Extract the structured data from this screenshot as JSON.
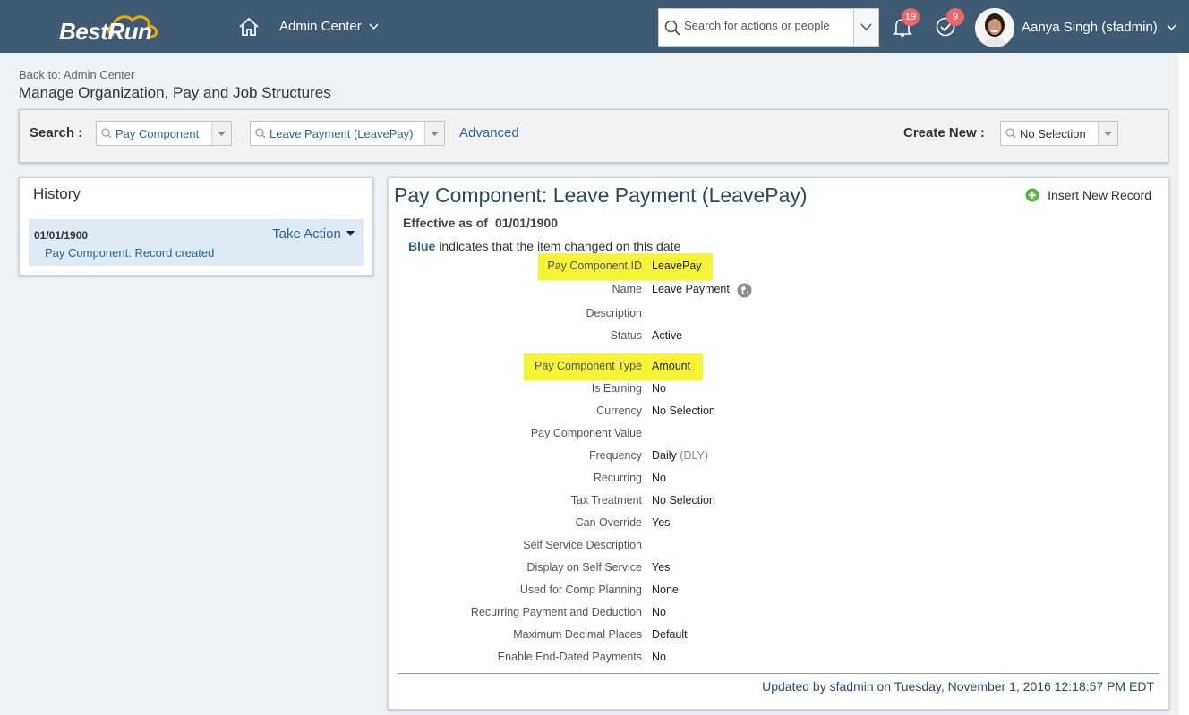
{
  "header": {
    "logo_text": "BestRun",
    "nav_title": "Admin Center",
    "search_placeholder": "Search for actions or people",
    "notifications_count": "19",
    "todo_count": "9",
    "user_name": "Aanya Singh (sfadmin)"
  },
  "breadcrumb": {
    "back_label": "Back to: Admin Center",
    "page_title": "Manage Organization, Pay and Job Structures"
  },
  "search_panel": {
    "search_label": "Search :",
    "type_value": "Pay Component",
    "record_value": "Leave Payment (LeavePay)",
    "advanced_label": "Advanced",
    "create_label": "Create New :",
    "create_value": "No Selection"
  },
  "history": {
    "title": "History",
    "items": [
      {
        "date": "01/01/1900",
        "action_label": "Take Action",
        "description": "Pay Component: Record created"
      }
    ]
  },
  "detail": {
    "title": "Pay Component: Leave Payment (LeavePay)",
    "insert_label": "Insert New Record",
    "effective_label": "Effective as of",
    "effective_date": "01/01/1900",
    "blue_word": "Blue",
    "blue_note": "indicates that the item changed on this date",
    "fields": [
      {
        "label": "Pay Component ID",
        "value": "LeavePay",
        "highlight": true
      },
      {
        "label": "Name",
        "value": "Leave Payment"
      },
      {
        "label": "Description",
        "value": ""
      },
      {
        "label": "Status",
        "value": "Active"
      },
      {
        "label": "Pay Component Type",
        "value": "Amount",
        "highlight": true
      },
      {
        "label": "Is Earning",
        "value": "No"
      },
      {
        "label": "Currency",
        "value": "No Selection"
      },
      {
        "label": "Pay Component Value",
        "value": ""
      },
      {
        "label": "Frequency",
        "value": "Daily",
        "value_extra": "(DLY)"
      },
      {
        "label": "Recurring",
        "value": "No"
      },
      {
        "label": "Tax Treatment",
        "value": "No Selection"
      },
      {
        "label": "Can Override",
        "value": "Yes"
      },
      {
        "label": "Self Service Description",
        "value": ""
      },
      {
        "label": "Display on Self Service",
        "value": "Yes"
      },
      {
        "label": "Used for Comp Planning",
        "value": "None"
      },
      {
        "label": "Recurring Payment and Deduction",
        "value": "No"
      },
      {
        "label": "Maximum Decimal Places",
        "value": "Default"
      },
      {
        "label": "Enable End-Dated Payments",
        "value": "No"
      }
    ],
    "updated_text": "Updated by sfadmin on Tuesday, November 1, 2016 12:18:57 PM EDT"
  },
  "colors": {
    "header_bg": "#3f5a73",
    "link_blue": "#2a6496",
    "highlight": "#f5f535",
    "badge": "#e8696b"
  }
}
